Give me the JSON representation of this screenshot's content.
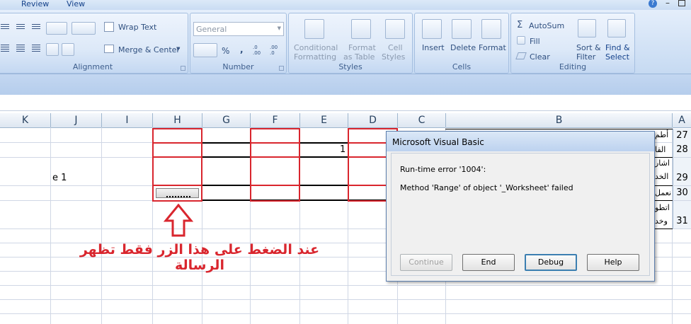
{
  "menu": {
    "tabs": [
      "Review",
      "View"
    ]
  },
  "alignment": {
    "wrap_text": "Wrap Text",
    "merge_center": "Merge & Center",
    "label": "Alignment"
  },
  "number": {
    "format_value": "General",
    "percent": "%",
    "comma": ",",
    "inc_decimal": ".0 .00",
    "dec_decimal": ".00 .0",
    "label": "Number"
  },
  "styles": {
    "conditional_1": "Conditional",
    "conditional_2": "Formatting",
    "format_as_1": "Format",
    "format_as_2": "as Table",
    "cell_styles_1": "Cell",
    "cell_styles_2": "Styles",
    "label": "Styles"
  },
  "cells": {
    "insert": "Insert",
    "delete": "Delete",
    "format": "Format",
    "label": "Cells"
  },
  "editing": {
    "autosum": "AutoSum",
    "fill": "Fill",
    "clear": "Clear",
    "sort_1": "Sort &",
    "sort_2": "Filter",
    "find_1": "Find &",
    "find_2": "Select",
    "label": "Editing"
  },
  "columns": [
    "K",
    "J",
    "I",
    "H",
    "G",
    "F",
    "E",
    "D",
    "C",
    "B",
    "A"
  ],
  "rows": {
    "r27": "27",
    "r28": "28",
    "r29": "29",
    "r30": "30",
    "r31": "31"
  },
  "cells_text": {
    "e28": "1",
    "j29": "e 1"
  },
  "b_col_fragments": [
    "أطم",
    "القا",
    "اشار",
    "الخد",
    "نعمل",
    "اتطو",
    "وخد"
  ],
  "annotation": {
    "text": "عند الضغط على هذا الزر فقط تظهر الرسالة",
    "color": "#d9262e"
  },
  "dialog": {
    "title": "Microsoft Visual Basic",
    "error_line": "Run-time error '1004':",
    "message": "Method 'Range' of object '_Worksheet' failed",
    "buttons": {
      "continue": "Continue",
      "end": "End",
      "debug": "Debug",
      "help": "Help"
    }
  }
}
